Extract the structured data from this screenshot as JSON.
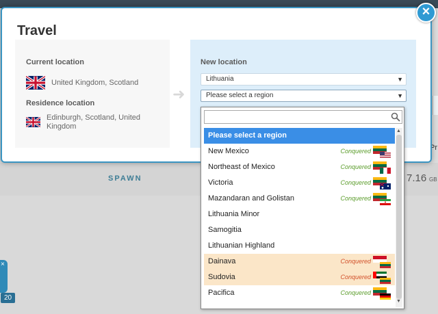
{
  "modal": {
    "title": "Travel",
    "close_label": "×"
  },
  "current": {
    "heading": "Current location",
    "value": "United Kingdom, Scotland"
  },
  "residence": {
    "heading": "Residence location",
    "value": "Edinburgh, Scotland, United Kingdom"
  },
  "new_location": {
    "heading": "New location",
    "country_selected": "Lithuania",
    "region_selected": "Please select a region",
    "search_value": ""
  },
  "dropdown": {
    "options": [
      {
        "label": "Please select a region",
        "status": "",
        "selected": true,
        "highlight": false
      },
      {
        "label": "New Mexico",
        "status": "Conquered",
        "selected": false,
        "highlight": false
      },
      {
        "label": "Northeast of Mexico",
        "status": "Conquered",
        "selected": false,
        "highlight": false
      },
      {
        "label": "Victoria",
        "status": "Conquered",
        "selected": false,
        "highlight": false
      },
      {
        "label": "Mazandaran and Golistan",
        "status": "Conquered",
        "selected": false,
        "highlight": false
      },
      {
        "label": "Lithuania Minor",
        "status": "",
        "selected": false,
        "highlight": false
      },
      {
        "label": "Samogitia",
        "status": "",
        "selected": false,
        "highlight": false
      },
      {
        "label": "Lithuanian Highland",
        "status": "",
        "selected": false,
        "highlight": false
      },
      {
        "label": "Dainava",
        "status": "Conquered",
        "selected": false,
        "highlight": true
      },
      {
        "label": "Sudovia",
        "status": "Conquered",
        "selected": false,
        "highlight": true
      },
      {
        "label": "Pacifica",
        "status": "Conquered",
        "selected": false,
        "highlight": false
      }
    ]
  },
  "background": {
    "spawn_label": "SPAWN",
    "gb_value": "7.16",
    "gb_unit": "GB",
    "partial_text": "Pr",
    "side_badge": "20",
    "side_close": "×"
  },
  "colors": {
    "accent": "#2f9ad3",
    "selected_option": "#3a8ee6",
    "highlight_option": "#fbe6c8",
    "conquered_green": "#5a9c2a",
    "conquered_red": "#d2502a"
  },
  "icons": {
    "close": "close-icon",
    "search": "search-icon",
    "arrow": "arrow-right-icon",
    "caret": "caret-down-icon"
  }
}
